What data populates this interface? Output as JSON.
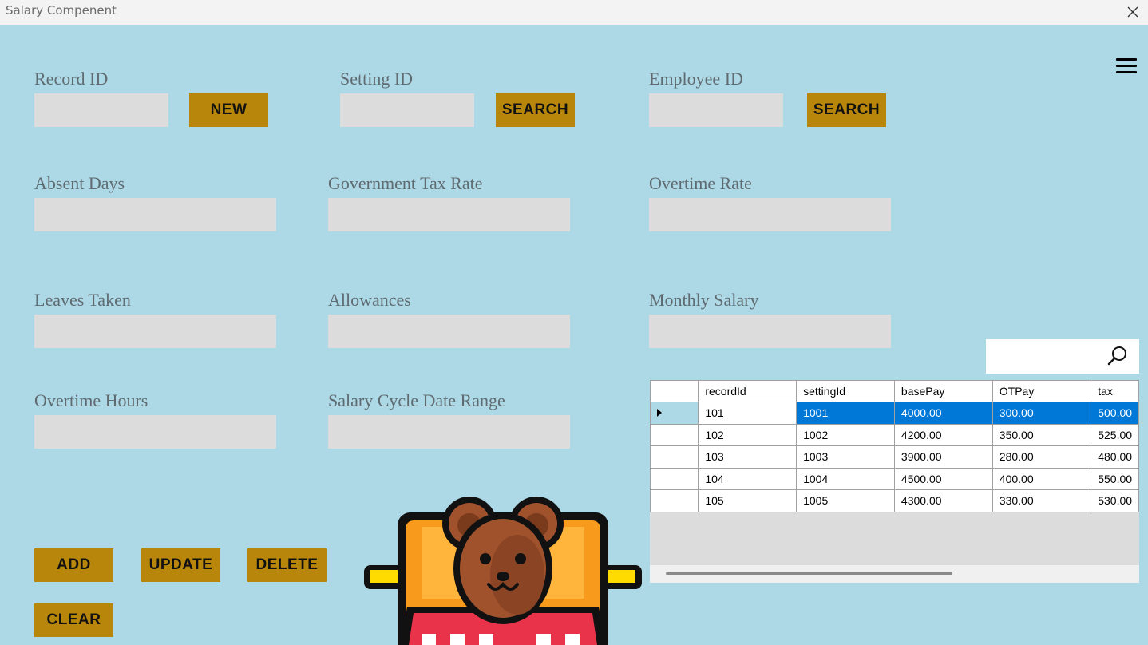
{
  "window": {
    "title": "Salary Compenent"
  },
  "labels": {
    "record_id": "Record ID",
    "setting_id": "Setting ID",
    "employee_id": "Employee ID",
    "absent_days": "Absent Days",
    "gov_tax_rate": "Government Tax Rate",
    "overtime_rate": "Overtime Rate",
    "leaves_taken": "Leaves Taken",
    "allowances": "Allowances",
    "monthly_salary": "Monthly Salary",
    "overtime_hours": "Overtime Hours",
    "salary_cycle": "Salary Cycle Date Range"
  },
  "fields": {
    "record_id": "",
    "setting_id": "",
    "employee_id": "",
    "absent_days": "",
    "gov_tax_rate": "",
    "overtime_rate": "",
    "leaves_taken": "",
    "allowances": "",
    "monthly_salary": "",
    "overtime_hours": "",
    "salary_cycle": "",
    "search": ""
  },
  "buttons": {
    "new": "NEW",
    "search_setting": "SEARCH",
    "search_employee": "SEARCH",
    "add": "ADD",
    "update": "UPDATE",
    "delete": "DELETE",
    "clear": "CLEAR"
  },
  "grid": {
    "columns": [
      "recordId",
      "settingId",
      "basePay",
      "OTPay",
      "tax"
    ],
    "rows": [
      [
        "101",
        "1001",
        "4000.00",
        "300.00",
        "500.00"
      ],
      [
        "102",
        "1002",
        "4200.00",
        "350.00",
        "525.00"
      ],
      [
        "103",
        "1003",
        "3900.00",
        "280.00",
        "480.00"
      ],
      [
        "104",
        "1004",
        "4500.00",
        "400.00",
        "550.00"
      ],
      [
        "105",
        "1005",
        "4300.00",
        "330.00",
        "530.00"
      ]
    ],
    "selected_row": 0
  },
  "icons": {
    "close": "close-icon",
    "menu": "hamburger-menu-icon",
    "search": "search-icon",
    "mascot": "bear-mascot-icon"
  },
  "colors": {
    "background": "#add8e6",
    "button": "#b8860b",
    "field": "#dcdcdc",
    "selection": "#0078d7"
  }
}
